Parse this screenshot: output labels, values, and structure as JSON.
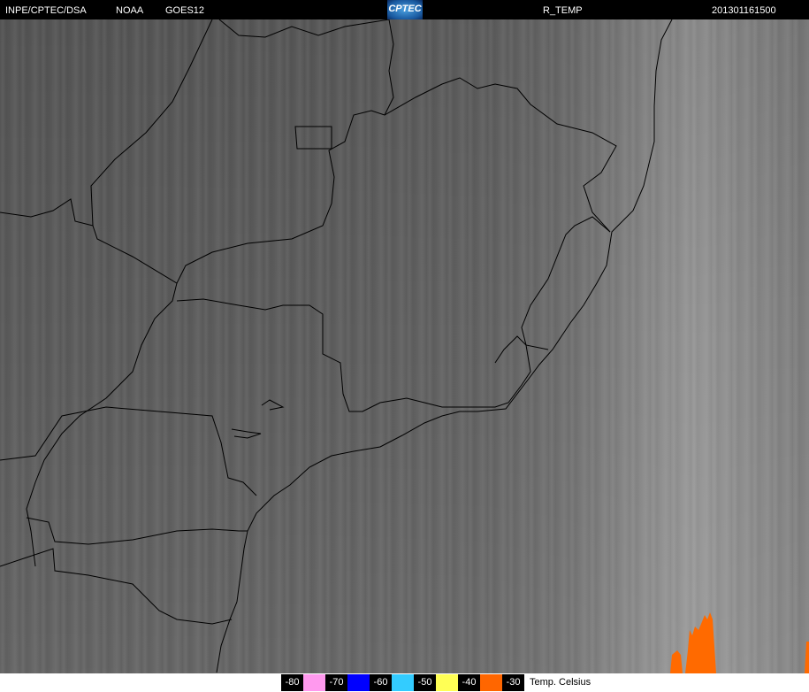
{
  "header": {
    "org": "INPE/CPTEC/DSA",
    "agency": "NOAA",
    "satellite": "GOES12",
    "logo": "CPTEC",
    "product": "R_TEMP",
    "timestamp": "201301161500"
  },
  "legend": {
    "items": [
      {
        "label": "-80",
        "color": "#ff99ee"
      },
      {
        "label": "-70",
        "color": "#0000ff"
      },
      {
        "label": "-60",
        "color": "#33ccff"
      },
      {
        "label": "-50",
        "color": "#ffff55"
      },
      {
        "label": "-40",
        "color": "#ff6600"
      },
      {
        "label": "-30"
      }
    ],
    "unit": "Temp. Celsius"
  },
  "colors": {
    "cloud_top": "#ff6a00",
    "border": "#000000"
  }
}
